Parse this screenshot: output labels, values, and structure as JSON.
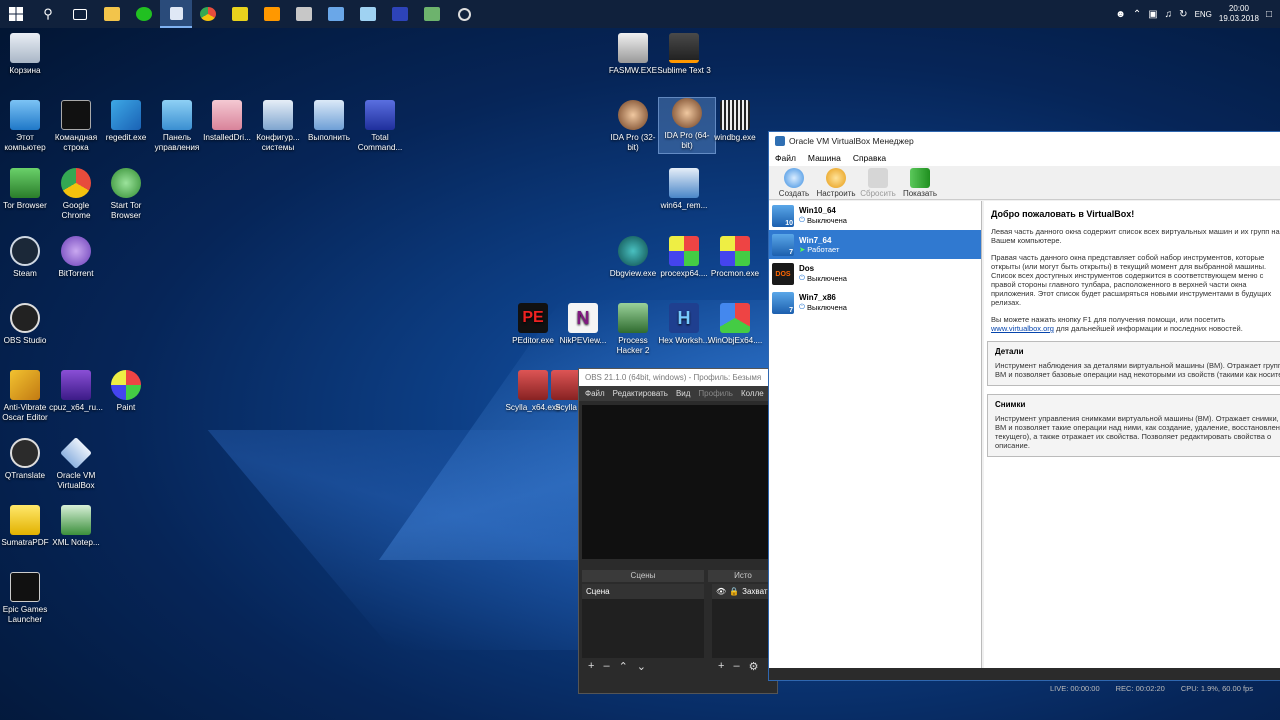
{
  "tray": {
    "lang": "ENG",
    "time": "20:00",
    "date": "19.03.2018"
  },
  "desktop_icons": [
    {
      "label": "Корзина"
    },
    {
      "label": "Этот компьютер"
    },
    {
      "label": "Командная строка"
    },
    {
      "label": "regedit.exe"
    },
    {
      "label": "Панель управления"
    },
    {
      "label": "InstalledDri..."
    },
    {
      "label": "Конфигур... системы"
    },
    {
      "label": "Выполнить"
    },
    {
      "label": "Total Command..."
    },
    {
      "label": "Tor Browser"
    },
    {
      "label": "Google Chrome"
    },
    {
      "label": "Start Tor Browser"
    },
    {
      "label": "Steam"
    },
    {
      "label": "BitTorrent"
    },
    {
      "label": "OBS Studio"
    },
    {
      "label": "Anti-Vibrate Oscar Editor"
    },
    {
      "label": "cpuz_x64_ru..."
    },
    {
      "label": "Paint"
    },
    {
      "label": "QTranslate"
    },
    {
      "label": "Oracle VM VirtualBox"
    },
    {
      "label": "SumatraPDF"
    },
    {
      "label": "XML Notep..."
    },
    {
      "label": "Epic Games Launcher"
    },
    {
      "label": "FASMW.EXE"
    },
    {
      "label": "Sublime Text 3"
    },
    {
      "label": "IDA Pro (32-bit)"
    },
    {
      "label": "IDA Pro (64-bit)"
    },
    {
      "label": "windbg.exe"
    },
    {
      "label": "win64_rem..."
    },
    {
      "label": "Dbgview.exe"
    },
    {
      "label": "procexp64...."
    },
    {
      "label": "Procmon.exe"
    },
    {
      "label": "PEditor.exe"
    },
    {
      "label": "NikPEView..."
    },
    {
      "label": "Process Hacker 2"
    },
    {
      "label": "Hex Worksh..."
    },
    {
      "label": "WinObjEx64...."
    },
    {
      "label": "Scylla_x64.exe"
    },
    {
      "label": "Scylla"
    }
  ],
  "obs": {
    "title": "OBS 21.1.0 (64bit, windows) - Профиль: Безымя",
    "menu": [
      "Файл",
      "Редактировать",
      "Вид",
      "Профиль",
      "Колле"
    ],
    "scenes_header": "Сцены",
    "sources_header": "Исто",
    "scene_item": "Сцена",
    "source_item": "Захват э",
    "status": {
      "live": "LIVE: 00:00:00",
      "rec": "REC: 00:02:20",
      "cpu": "CPU: 1.9%, 60.00 fps"
    }
  },
  "vbox": {
    "title": "Oracle VM VirtualBox Менеджер",
    "menu": [
      "Файл",
      "Машина",
      "Справка"
    ],
    "toolbar": [
      "Создать",
      "Настроить",
      "Сбросить",
      "Показать"
    ],
    "vms": [
      {
        "name": "Win10_64",
        "state": "Выключена",
        "badge": "10"
      },
      {
        "name": "Win7_64",
        "state": "Работает",
        "badge": "7"
      },
      {
        "name": "Dos",
        "state": "Выключена",
        "badge": "DOS"
      },
      {
        "name": "Win7_x86",
        "state": "Выключена",
        "badge": "7"
      }
    ],
    "welcome_title": "Добро пожаловать в VirtualBox!",
    "p1": "Левая часть данного окна содержит список всех виртуальных машин и их групп на Вашем компьютере.",
    "p2": "Правая часть данного окна представляет собой набор инструментов, которые открыты (или могут быть открыты) в текущий момент для выбранной машины. Список всех доступных инструментов содержится в соответствующем меню с правой стороны главного тулбара, расположенного в верхней части окна приложения. Этот список будет расширяться новыми инструментами в будущих релизах.",
    "p3a": "Вы можете нажать кнопку F1 для получения помощи, или посетить",
    "p3link": "www.virtualbox.org",
    "p3b": "для дальнейшей информации и последних новостей.",
    "details_title": "Детали",
    "details_text1": "Инструмент наблюдения за деталями виртуальной машины (ВМ). Отражает групп",
    "details_text2": "ВМ и позволяет базовые операции над некоторыми из свойств (такими как носите",
    "snap_title": "Снимки",
    "snap_text1": "Инструмент управления снимками виртуальной машины (ВМ). Отражает снимки, с",
    "snap_text2": "ВМ и позволяет такие операции над ними, как создание, удаление, восстановлен",
    "snap_text3": "текущего), а также отражает их свойства. Позволяет редактировать свойства о",
    "snap_text4": "описание."
  }
}
